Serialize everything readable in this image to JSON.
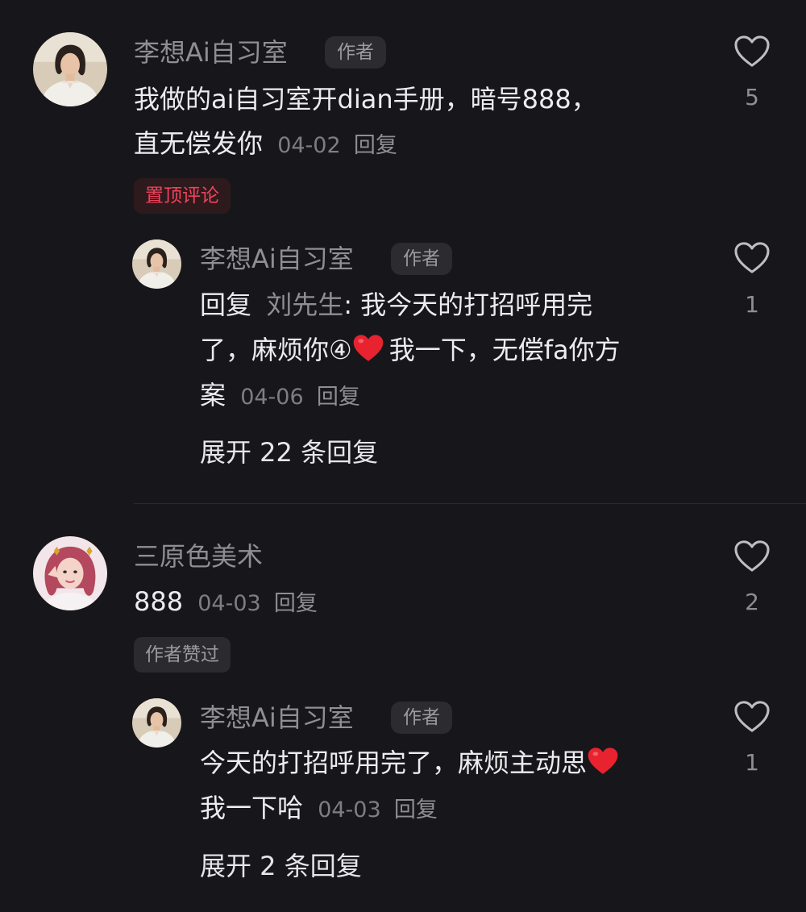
{
  "comments": [
    {
      "author": "李想Ai自习室",
      "author_tag": "作者",
      "text_line1": "我做的ai自习室开dian手册，暗号888，",
      "text_line2": "直无偿发你",
      "date": "04-02",
      "reply_label": "回复",
      "likes": "5",
      "badge": "置顶评论",
      "avatar_icon": "woman-portrait-avatar",
      "reply": {
        "author": "李想Ai自习室",
        "author_tag": "作者",
        "reply_prefix": "回复",
        "mention": "刘先生",
        "text_line1": ": 我今天的打招呼用完",
        "text_line2a": "了，麻烦你④",
        "text_line2b": "我一下，无偿fa你方",
        "text_line3": "案",
        "date": "04-06",
        "reply_label": "回复",
        "likes": "1",
        "emoji": "red-heart-emoji"
      },
      "expand_label": "展开 22 条回复"
    },
    {
      "author": "三原色美术",
      "text_line1": "888",
      "date": "04-03",
      "reply_label": "回复",
      "likes": "2",
      "badge": "作者赞过",
      "avatar_icon": "girl-portrait-avatar",
      "reply": {
        "author": "李想Ai自习室",
        "author_tag": "作者",
        "text_line1": "今天的打招呼用完了，麻烦主动思",
        "text_line2": "我一下哈",
        "date": "04-03",
        "reply_label": "回复",
        "likes": "1",
        "emoji": "red-heart-emoji"
      },
      "expand_label": "展开 2 条回复"
    }
  ],
  "colors": {
    "background": "#17171b",
    "pin_red": "#f2435c",
    "heart_emoji": "#e8232f"
  }
}
